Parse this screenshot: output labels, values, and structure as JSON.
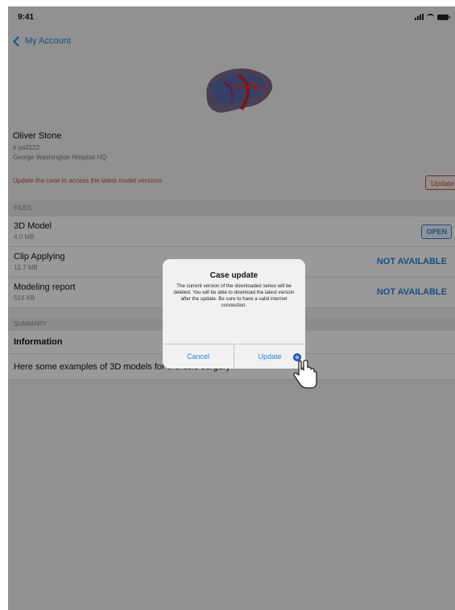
{
  "status_bar": {
    "time": "9:41"
  },
  "nav": {
    "back_label": "My Account"
  },
  "patient": {
    "name": "Oliver Stone",
    "id": "# ps0122",
    "hospital": "George Washington Hospital HQ",
    "update_warning": "Update the case to access the latest model versions",
    "update_label": "Update"
  },
  "sections": {
    "files": "FILES",
    "summary": "SUMMARY"
  },
  "files": [
    {
      "title": "3D Model",
      "subtitle": "4.0 MB",
      "action": "OPEN"
    },
    {
      "title": "Clip Applying",
      "subtitle": "12.7 MB",
      "action": "NOT AVAILABLE"
    },
    {
      "title": "Modeling report",
      "subtitle": "514 KB",
      "action": "NOT AVAILABLE"
    }
  ],
  "summary": {
    "title": "Information",
    "text": "Here some examples of 3D models for thoracic surgery"
  },
  "dialog": {
    "title": "Case update",
    "message": "The current version of the downloaded series will be deleted. You will be able to download the latest version after the update. Be sure to have a valid internet connection.",
    "cancel_label": "Cancel",
    "update_label": "Update"
  },
  "colors": {
    "accent": "#2f7fde",
    "warning": "#c94a3a"
  }
}
